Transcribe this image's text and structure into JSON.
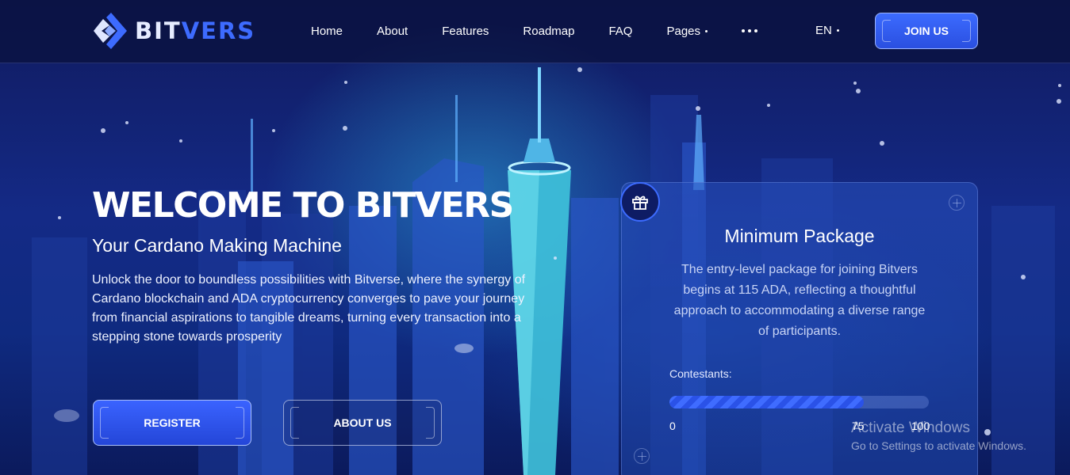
{
  "header": {
    "logo": {
      "part1": "BIT",
      "part2": "VERS"
    },
    "nav": [
      {
        "label": "Home",
        "has_dropdown": false
      },
      {
        "label": "About",
        "has_dropdown": false
      },
      {
        "label": "Features",
        "has_dropdown": false
      },
      {
        "label": "Roadmap",
        "has_dropdown": false
      },
      {
        "label": "FAQ",
        "has_dropdown": false
      },
      {
        "label": "Pages",
        "has_dropdown": true
      }
    ],
    "more_icon": "more-dots-icon",
    "language": "EN",
    "join_label": "JOIN US"
  },
  "hero": {
    "title": "WELCOME TO BITVERS",
    "subtitle": "Your Cardano Making Machine",
    "description": "Unlock the door to boundless possibilities with Bitverse, where the synergy of Cardano blockchain and ADA cryptocurrency converges to pave your journey from financial aspirations to tangible dreams, turning every transaction into a stepping stone towards prosperity",
    "register_label": "REGISTER",
    "about_label": "ABOUT US"
  },
  "package": {
    "icon": "gift-icon",
    "title": "Minimum Package",
    "description": "The entry-level package for joining Bitvers begins at 115 ADA, reflecting a thoughtful approach to accommodating a diverse range of participants.",
    "contestants_label": "Contestants:",
    "progress_value": 75,
    "progress_max": 100,
    "ticks": [
      "0",
      "75",
      "100"
    ]
  },
  "watermark": {
    "title": "Activate Windows",
    "subtitle": "Go to Settings to activate Windows."
  },
  "colors": {
    "accent": "#3c6bff",
    "background": "#0d1650"
  }
}
